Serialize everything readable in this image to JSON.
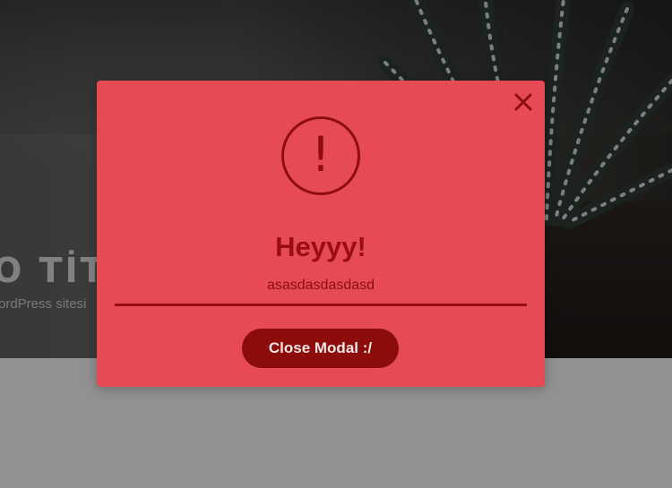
{
  "background_page": {
    "hero_title": "O TİT",
    "hero_subtitle": "ordPress sitesi"
  },
  "modal": {
    "close_icon": "close-icon",
    "alert_icon": "exclamation-circle-icon",
    "alert_glyph": "!",
    "title": "Heyyy!",
    "message": "asasdasdasdasd",
    "button_label": "Close Modal :/"
  },
  "colors": {
    "modal_bg": "#e54a55",
    "accent_dark": "#8c0c0a",
    "title": "#9a0f0e",
    "button_text": "#f6e3e3"
  }
}
